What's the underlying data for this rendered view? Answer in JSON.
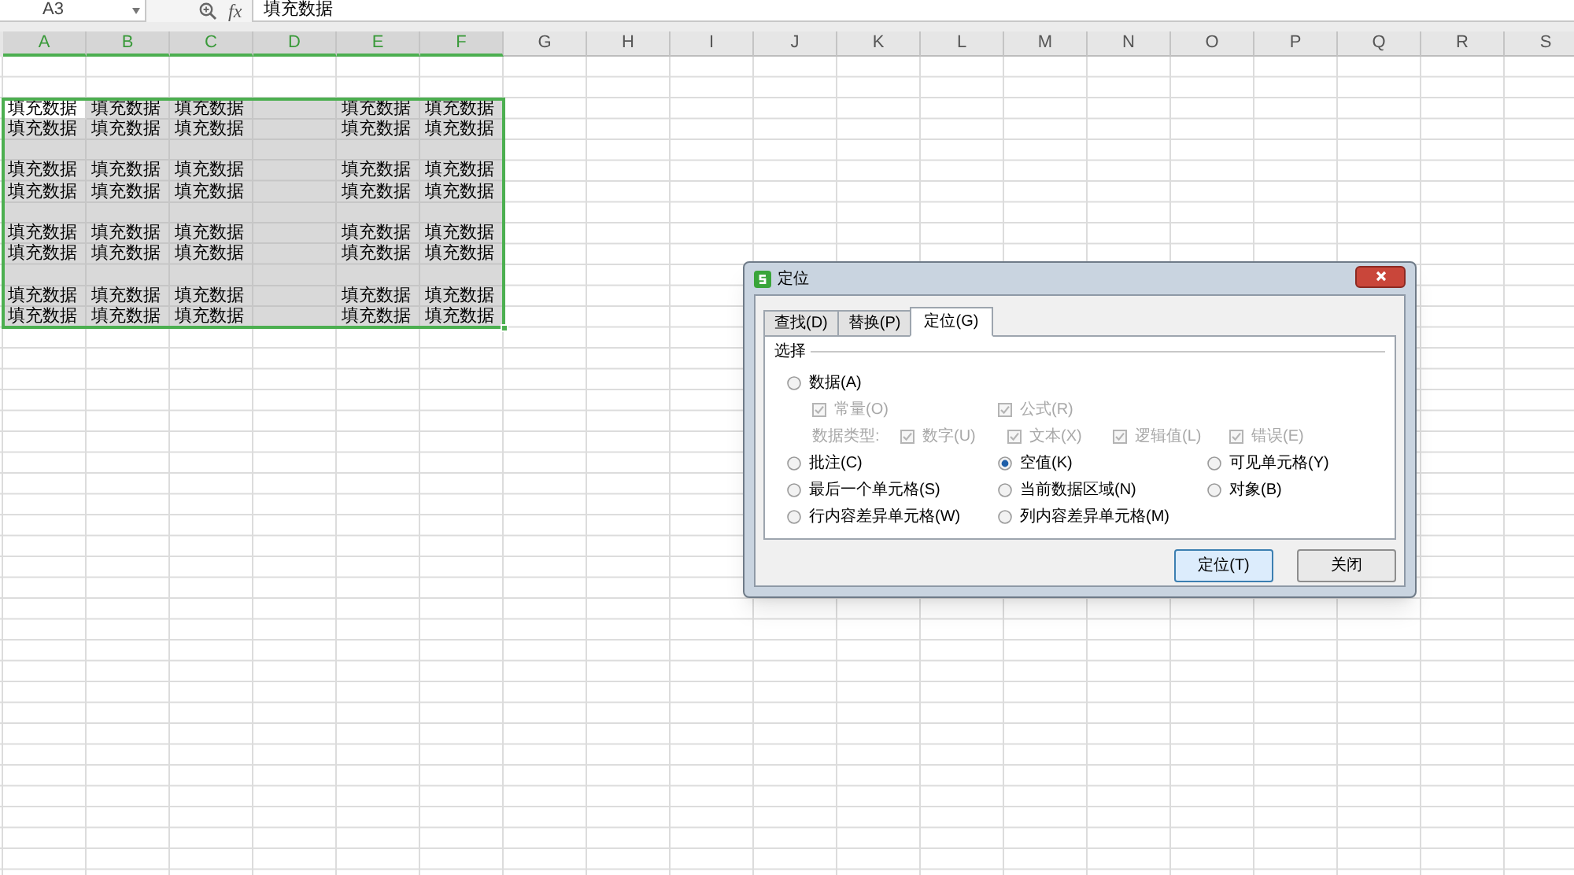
{
  "formula_bar": {
    "name_box": "A3",
    "function_label": "fx",
    "formula": "填充数据"
  },
  "columns": [
    {
      "label": "A",
      "selected": true
    },
    {
      "label": "B",
      "selected": true
    },
    {
      "label": "C",
      "selected": true
    },
    {
      "label": "D",
      "selected": true
    },
    {
      "label": "E",
      "selected": true
    },
    {
      "label": "F",
      "selected": true
    },
    {
      "label": "G",
      "selected": false
    },
    {
      "label": "H",
      "selected": false
    },
    {
      "label": "I",
      "selected": false
    },
    {
      "label": "J",
      "selected": false
    },
    {
      "label": "K",
      "selected": false
    },
    {
      "label": "L",
      "selected": false
    },
    {
      "label": "M",
      "selected": false
    },
    {
      "label": "N",
      "selected": false
    },
    {
      "label": "O",
      "selected": false
    },
    {
      "label": "P",
      "selected": false
    },
    {
      "label": "Q",
      "selected": false
    },
    {
      "label": "R",
      "selected": false
    },
    {
      "label": "S",
      "selected": false
    }
  ],
  "rows": [
    {
      "selected": true,
      "cells": [
        {
          "text": "填充数据",
          "active": true
        },
        {
          "text": "填充数据",
          "active": false
        },
        {
          "text": "填充数据",
          "active": false
        },
        {
          "active": false
        },
        {
          "text": "填充数据",
          "active": false
        },
        {
          "text": "填充数据",
          "active": false
        }
      ]
    },
    {
      "selected": true,
      "cells": [
        {
          "text": "填充数据",
          "active": false
        },
        {
          "text": "填充数据",
          "active": false
        },
        {
          "text": "填充数据",
          "active": false
        },
        {
          "active": false
        },
        {
          "text": "填充数据",
          "active": false
        },
        {
          "text": "填充数据",
          "active": false
        }
      ]
    },
    {
      "selected": true
    },
    {
      "selected": true,
      "cells": [
        {
          "text": "填充数据",
          "active": false
        },
        {
          "text": "填充数据",
          "active": false
        },
        {
          "text": "填充数据",
          "active": false
        },
        {
          "active": false
        },
        {
          "text": "填充数据",
          "active": false
        },
        {
          "text": "填充数据",
          "active": false
        }
      ]
    },
    {
      "selected": true,
      "cells": [
        {
          "text": "填充数据",
          "active": false
        },
        {
          "text": "填充数据",
          "active": false
        },
        {
          "text": "填充数据",
          "active": false
        },
        {
          "active": false
        },
        {
          "text": "填充数据",
          "active": false
        },
        {
          "text": "填充数据",
          "active": false
        }
      ]
    },
    {
      "selected": true
    },
    {
      "selected": true,
      "cells": [
        {
          "text": "填充数据",
          "active": false
        },
        {
          "text": "填充数据",
          "active": false
        },
        {
          "text": "填充数据",
          "active": false
        },
        {
          "active": false
        },
        {
          "text": "填充数据",
          "active": false
        },
        {
          "text": "填充数据",
          "active": false
        }
      ]
    },
    {
      "selected": true,
      "cells": [
        {
          "text": "填充数据",
          "active": false
        },
        {
          "text": "填充数据",
          "active": false
        },
        {
          "text": "填充数据",
          "active": false
        },
        {
          "active": false
        },
        {
          "text": "填充数据",
          "active": false
        },
        {
          "text": "填充数据",
          "active": false
        }
      ]
    },
    {
      "selected": true
    },
    {
      "selected": true,
      "cells": [
        {
          "text": "填充数据",
          "active": false
        },
        {
          "text": "填充数据",
          "active": false
        },
        {
          "text": "填充数据",
          "active": false
        },
        {
          "active": false
        },
        {
          "text": "填充数据",
          "active": false
        },
        {
          "text": "填充数据",
          "active": false
        }
      ]
    },
    {
      "selected": true,
      "cells": [
        {
          "text": "填充数据",
          "active": false
        },
        {
          "text": "填充数据",
          "active": false
        },
        {
          "text": "填充数据",
          "active": false
        },
        {
          "active": false
        },
        {
          "text": "填充数据",
          "active": false
        },
        {
          "text": "填充数据",
          "active": false
        }
      ]
    }
  ],
  "dialog": {
    "title": "定位",
    "tabs": [
      {
        "label": "查找(D)",
        "selected": false
      },
      {
        "label": "替换(P)",
        "selected": false
      },
      {
        "label": "定位(G)",
        "selected": true
      }
    ],
    "group_label": "选择",
    "data_option": {
      "label": "数据(A)",
      "selected": false
    },
    "data_sub_options": [
      {
        "label": "常量(O)",
        "checked": true,
        "disabled": true
      },
      {
        "label": "公式(R)",
        "checked": true,
        "disabled": true
      }
    ],
    "data_types_label": "数据类型:",
    "data_types": [
      {
        "label": "数字(U)",
        "checked": true,
        "disabled": true
      },
      {
        "label": "文本(X)",
        "checked": true,
        "disabled": true
      },
      {
        "label": "逻辑值(L)",
        "checked": true,
        "disabled": true
      },
      {
        "label": "错误(E)",
        "checked": true,
        "disabled": true
      }
    ],
    "options": [
      {
        "label": "批注(C)",
        "selected": false
      },
      {
        "label": "空值(K)",
        "selected": true
      },
      {
        "label": "可见单元格(Y)",
        "selected": false
      },
      {
        "label": "最后一个单元格(S)",
        "selected": false
      },
      {
        "label": "当前数据区域(N)",
        "selected": false
      },
      {
        "label": "对象(B)",
        "selected": false
      },
      {
        "label": "行内容差异单元格(W)",
        "selected": false
      },
      {
        "label": "列内容差异单元格(M)",
        "selected": false
      }
    ],
    "buttons": [
      {
        "label": "定位(T)",
        "default": true
      },
      {
        "label": "关闭",
        "default": false
      }
    ]
  }
}
